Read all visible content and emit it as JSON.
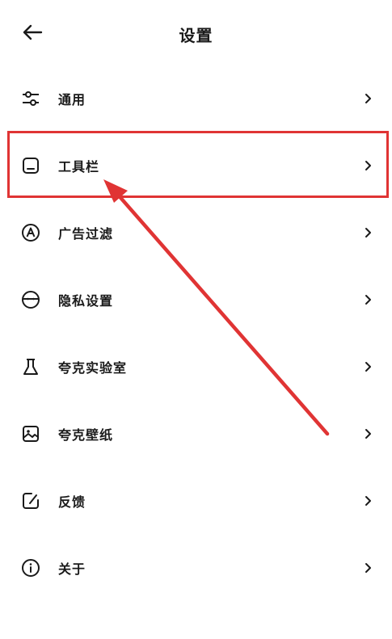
{
  "header": {
    "title": "设置",
    "back_icon": "arrow-left-icon"
  },
  "menu": {
    "items": [
      {
        "label": "通用",
        "icon": "sliders-icon"
      },
      {
        "label": "工具栏",
        "icon": "toolbar-icon"
      },
      {
        "label": "广告过滤",
        "icon": "ad-filter-icon"
      },
      {
        "label": "隐私设置",
        "icon": "privacy-icon"
      },
      {
        "label": "夸克实验室",
        "icon": "flask-icon"
      },
      {
        "label": "夸克壁纸",
        "icon": "wallpaper-icon"
      },
      {
        "label": "反馈",
        "icon": "feedback-icon"
      },
      {
        "label": "关于",
        "icon": "info-icon"
      }
    ],
    "chevron_icon": "chevron-right-icon"
  },
  "annotation": {
    "highlight_color": "#e03434",
    "highlighted_item": "工具栏"
  }
}
